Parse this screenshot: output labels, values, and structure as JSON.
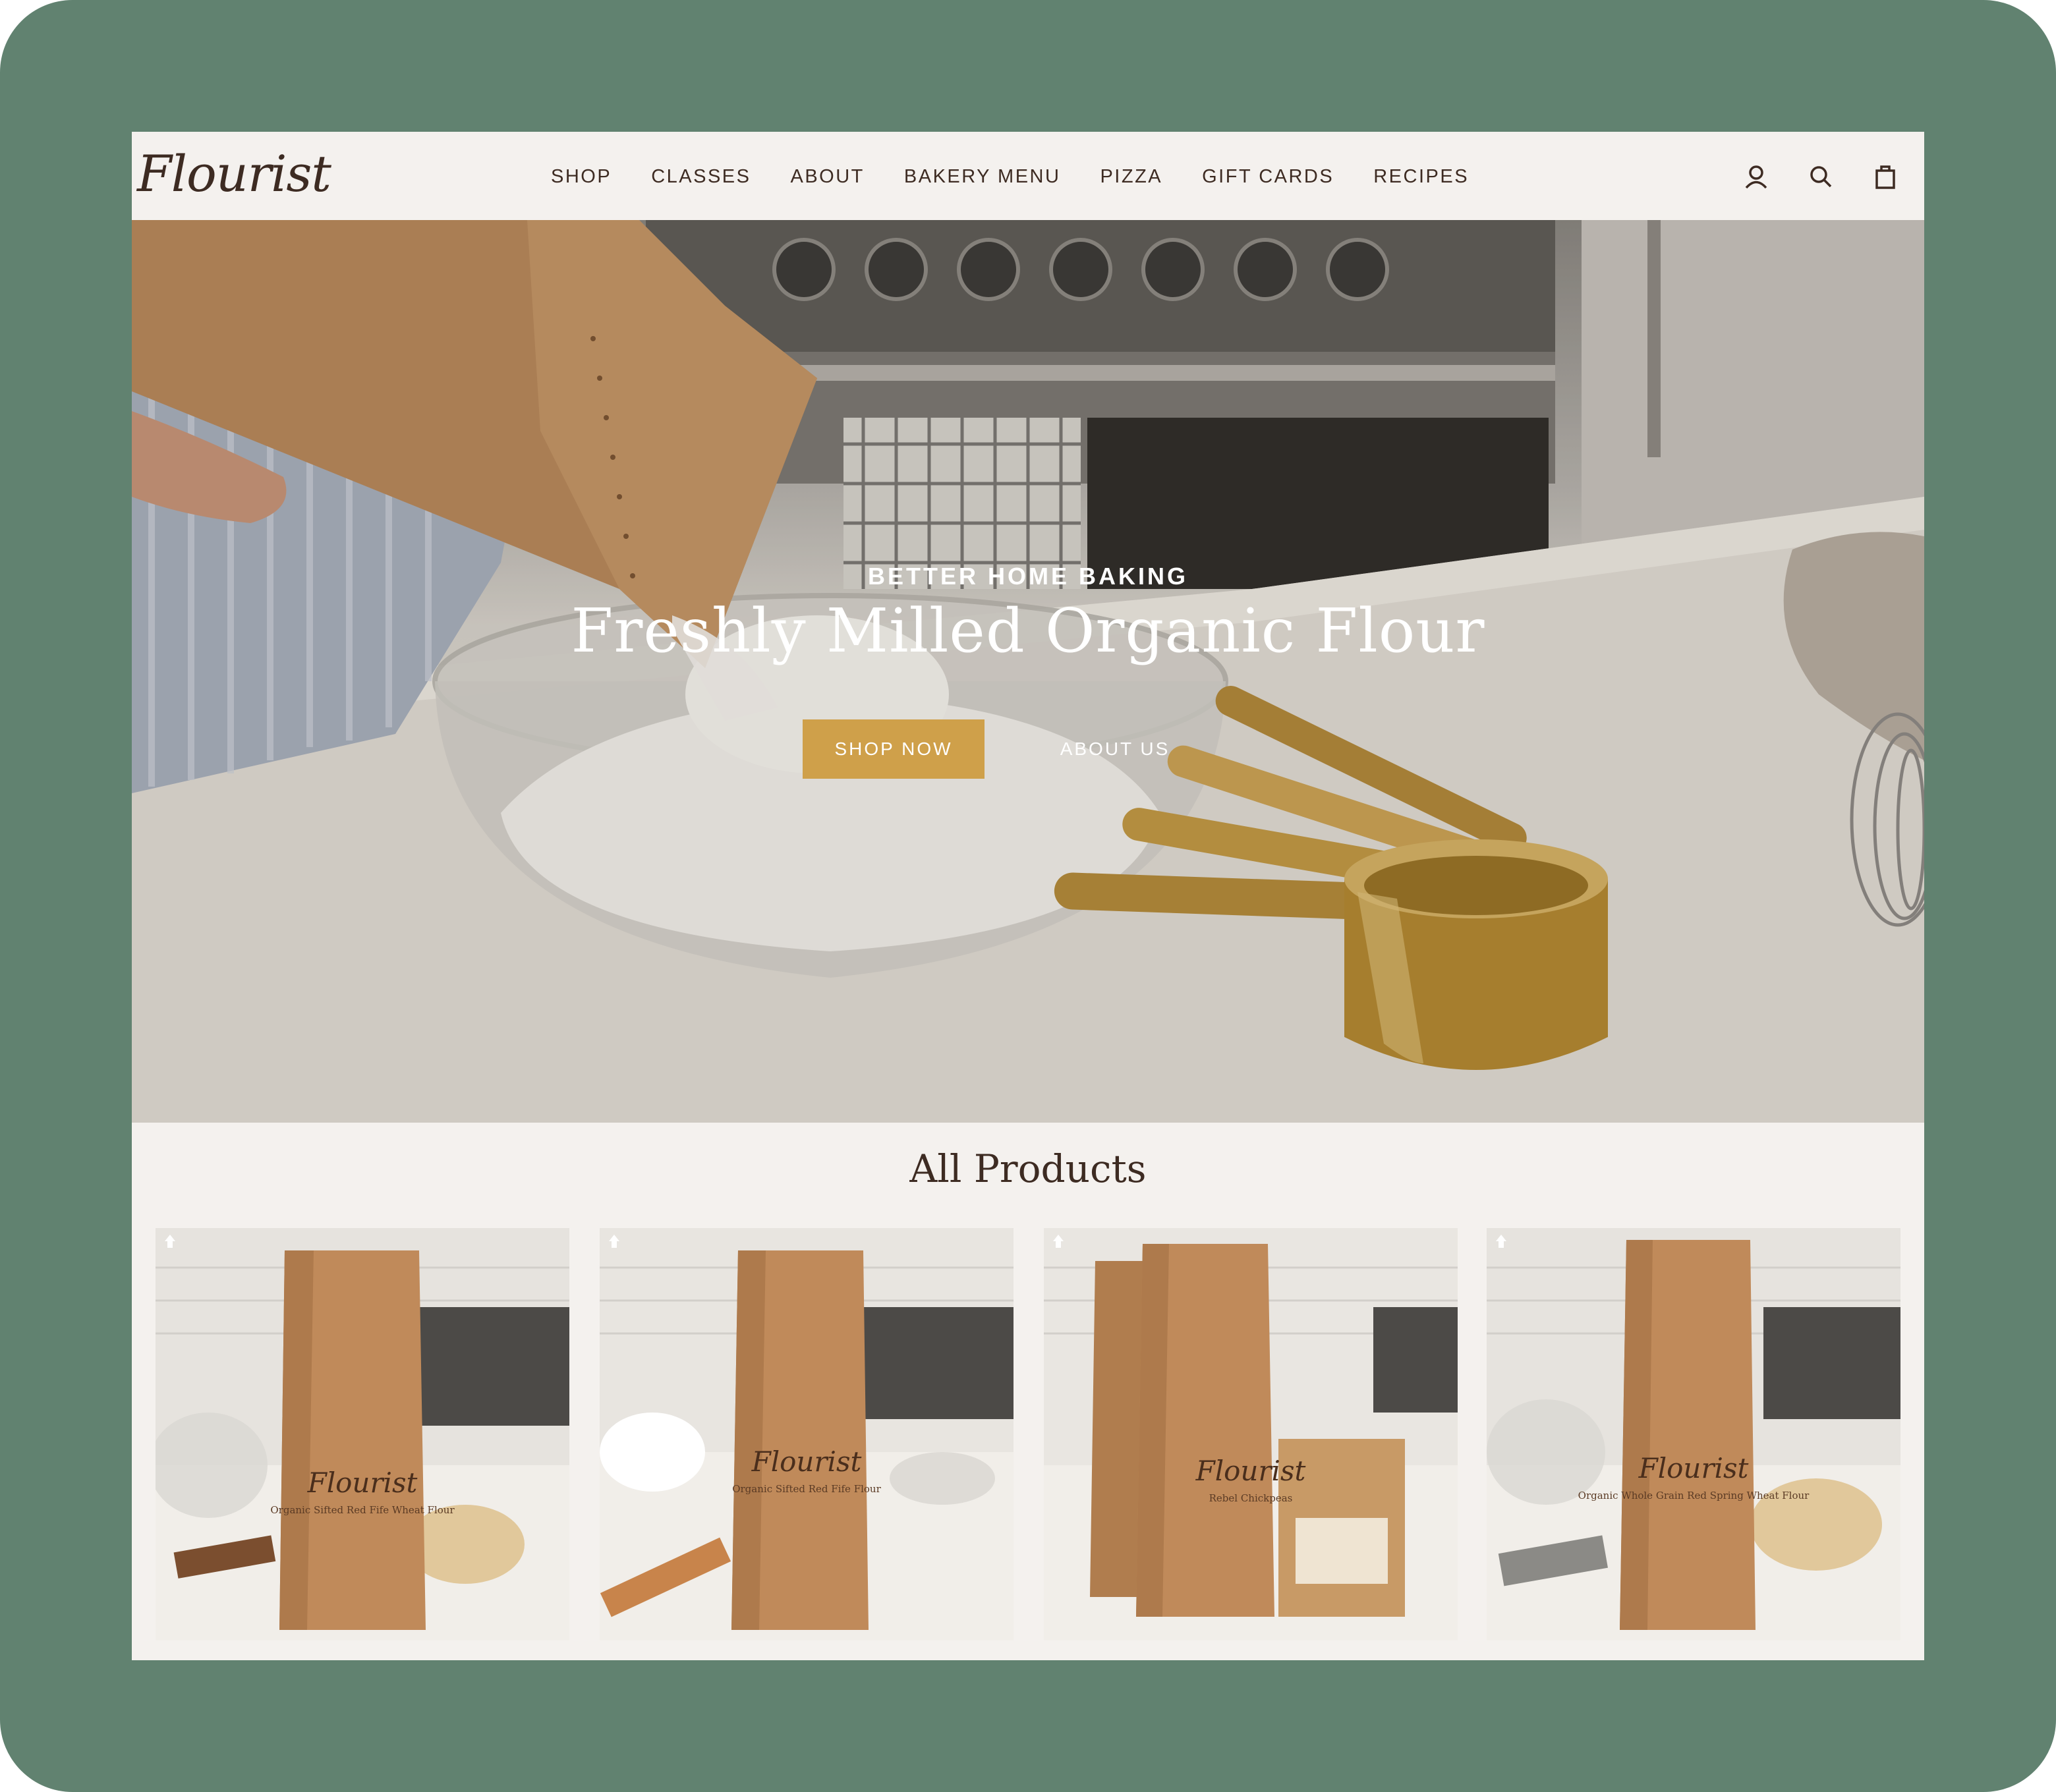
{
  "brand": {
    "logo_text": "Flourist"
  },
  "nav": {
    "items": [
      "SHOP",
      "CLASSES",
      "ABOUT",
      "BAKERY MENU",
      "PIZZA",
      "GIFT CARDS",
      "RECIPES"
    ]
  },
  "header_icons": [
    "account-icon",
    "search-icon",
    "cart-icon"
  ],
  "hero": {
    "kicker": "BETTER HOME BAKING",
    "title": "Freshly Milled Organic Flour",
    "primary_button": "SHOP NOW",
    "secondary_button": "ABOUT US"
  },
  "products": {
    "heading": "All Products",
    "cards": [
      {
        "brand": "Flourist",
        "name": "Organic Sifted Red Fife Wheat Flour"
      },
      {
        "brand": "Flourist",
        "name": "Organic Sifted Red Fife Flour"
      },
      {
        "brand": "Flourist",
        "name": "Rebel Chickpeas"
      },
      {
        "brand": "Flourist",
        "name": "Organic Whole Grain Red Spring Wheat Flour"
      }
    ]
  },
  "colors": {
    "frame": "#618270",
    "page_bg": "#f4f1ee",
    "text_dark": "#3d2b22",
    "accent_button": "#cfa04a",
    "kraft_bag": "#c08a5a"
  }
}
